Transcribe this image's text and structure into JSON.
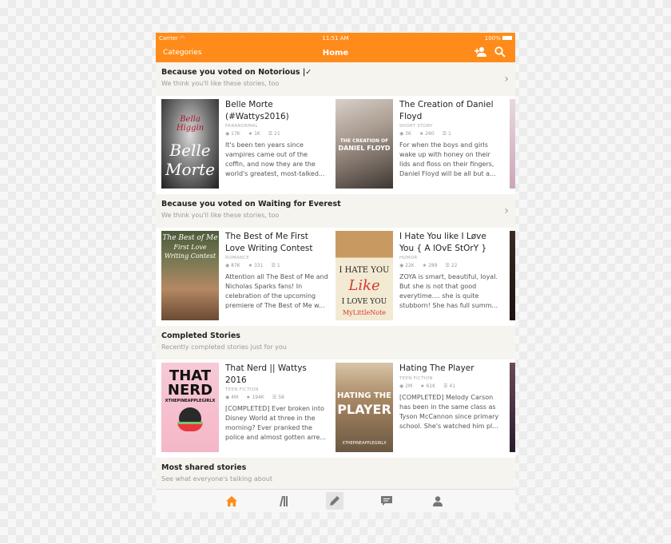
{
  "status": {
    "carrier": "Carrier",
    "time": "11:51 AM",
    "battery": "100%"
  },
  "nav": {
    "categories": "Categories",
    "title": "Home"
  },
  "sections": [
    {
      "heading": "Because you voted on Notorious |✓",
      "subheading": "We think you'll like these stories, too",
      "stories": [
        {
          "title": "Belle Morte (#Wattys2016)",
          "genre": "PARANORMAL",
          "reads": "17K",
          "votes": "1K",
          "parts": "21",
          "desc": "It's been ten years since vampires came out of the coffin, and now they are the world's greatest, most-talked...",
          "cover": {
            "lines": [
              "Bella",
              "Higgin",
              "Belle",
              "Morte"
            ]
          }
        },
        {
          "title": "The Creation of Daniel Floyd",
          "genre": "SHORT STORY",
          "reads": "3K",
          "votes": "260",
          "parts": "1",
          "desc": "For when the boys and girls wake up with honey on their lids and floss on their fingers, Daniel Floyd will be all but a...",
          "cover": {
            "lines": [
              "THE CREATION OF",
              "DANIEL FLOYD"
            ]
          }
        }
      ]
    },
    {
      "heading": "Because you voted on Waiting for Everest",
      "subheading": "We think you'll like these stories, too",
      "stories": [
        {
          "title": "The Best of Me First Love Writing Contest",
          "genre": "ROMANCE",
          "reads": "87K",
          "votes": "331",
          "parts": "1",
          "desc": "Attention all The Best of Me and Nicholas Sparks fans! In celebration of the upcoming premiere of The Best of Me w...",
          "cover": {
            "lines": [
              "The Best of Me",
              "First Love",
              "Writing Contest"
            ]
          }
        },
        {
          "title": "I Hate You like I Løve You { A lOvE StOrY }",
          "genre": "HUMOR",
          "reads": "22K",
          "votes": "289",
          "parts": "22",
          "desc": "ZOYA is smart, beautiful, loyal. But she is not that  good everytime.... she is quite stubborn! She has full summ...",
          "cover": {
            "lines": [
              "I HATE YOU",
              "Like",
              "I LOVE YOU",
              "MyLittleNote"
            ]
          }
        }
      ]
    },
    {
      "heading": "Completed Stories",
      "subheading": "Recently completed stories just for you",
      "stories": [
        {
          "title": "That Nerd || Wattys 2016",
          "genre": "TEEN FICTION",
          "reads": "4M",
          "votes": "194K",
          "parts": "58",
          "desc": "[COMPLETED] Ever broken into Disney World at three in the morning?  Ever pranked the police and almost gotten arre...",
          "cover": {
            "lines": [
              "THAT",
              "NERD",
              "XTHEPINEAPPLEGIRLX"
            ]
          }
        },
        {
          "title": "Hating The Player",
          "genre": "TEEN FICTION",
          "reads": "2M",
          "votes": "61K",
          "parts": "41",
          "desc": "[COMPLETED]  Melody Carson has been in the same class as Tyson McCannon since primary school.  She's watched him pl...",
          "cover": {
            "lines": [
              "HATING THE",
              "PLAYER",
              "XTHEPINEAPPLEGIRLX"
            ]
          }
        }
      ]
    },
    {
      "heading": "Most shared stories",
      "subheading": "See what everyone's talking about"
    }
  ],
  "tabbar": [
    "home-icon",
    "library-icon",
    "write-icon",
    "messages-icon",
    "profile-icon"
  ],
  "colors": {
    "accent": "#ff8c1a"
  }
}
